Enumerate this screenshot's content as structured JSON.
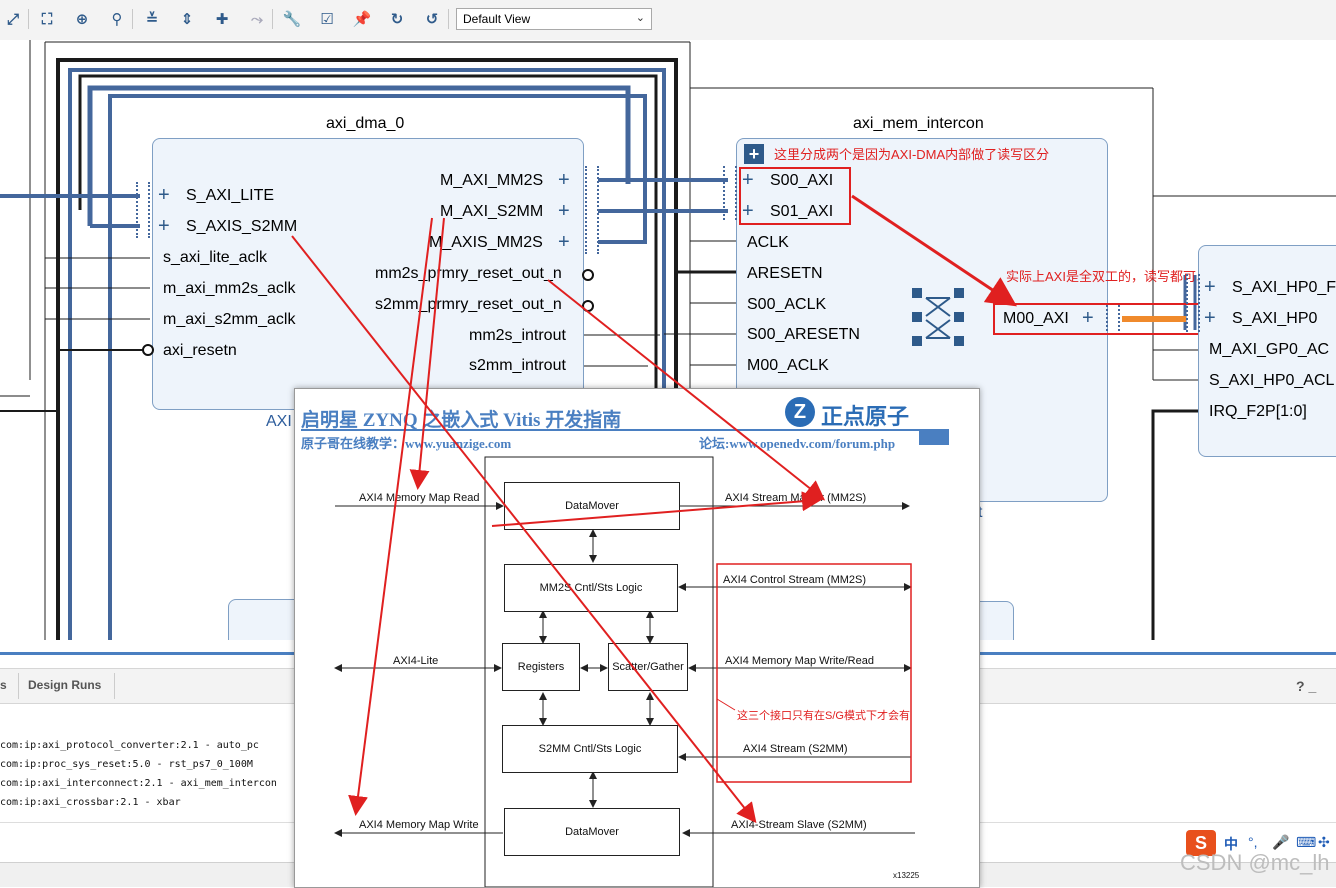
{
  "toolbar": {
    "icons": [
      "fit-icon",
      "fit-selection-icon",
      "auto-connect-icon",
      "zoom-icon",
      "collapse-icon",
      "expand-icon",
      "add-ip-icon",
      "run-connection-icon",
      "properties-icon",
      "validate-icon",
      "pin-icon",
      "refresh-icon",
      "regenerate-layout-icon"
    ],
    "view_label": "Default View"
  },
  "diagram": {
    "dma": {
      "name": "axi_dma_0",
      "left_ports": [
        "S_AXI_LITE",
        "S_AXIS_S2MM",
        "s_axi_lite_aclk",
        "m_axi_mm2s_aclk",
        "m_axi_s2mm_aclk",
        "axi_resetn"
      ],
      "right_ports": [
        "M_AXI_MM2S",
        "M_AXI_S2MM",
        "M_AXIS_MM2S",
        "mm2s_prmry_reset_out_n",
        "s2mm_prmry_reset_out_n",
        "mm2s_introut",
        "s2mm_introut"
      ],
      "footer_fragment": "AXI"
    },
    "interconnect": {
      "name": "axi_mem_intercon",
      "left_ports": [
        "S00_AXI",
        "S01_AXI",
        "ACLK",
        "ARESETN",
        "S00_ACLK",
        "S00_ARESETN",
        "M00_ACLK"
      ],
      "right_port": "M00_AXI",
      "footer_fragment": "t"
    },
    "zynq_ports": [
      "S_AXI_HP0_F",
      "S_AXI_HP0",
      "M_AXI_GP0_AC",
      "S_AXI_HP0_ACL",
      "IRQ_F2P[1:0]"
    ],
    "notes": {
      "split": "这里分成两个是因为AXI-DMA内部做了读写区分",
      "duplex": "实际上AXI是全双工的，读写都可以"
    },
    "colors": {
      "bus": "#44679c",
      "wire": "#1a1a1a",
      "block_bg": "#eef4fb",
      "block_border": "#7f9fc4",
      "annot": "#e02020",
      "hp_link": "#f08a2c"
    }
  },
  "bottom_panel": {
    "tabs": [
      "s",
      "Design Runs"
    ],
    "lines": [
      "com:ip:axi_protocol_converter:2.1 - auto_pc",
      "com:ip:proc_sys_reset:5.0 - rst_ps7_0_100M",
      "com:ip:axi_interconnect:2.1 - axi_mem_intercon",
      "com:ip:axi_crossbar:2.1 - xbar"
    ],
    "help": "? _"
  },
  "overlay": {
    "header_title": "启明星 ZYNQ 之嵌入式 Vitis 开发指南",
    "brand": "正点原子",
    "left_caption": "原子哥在线教学：www.yuanzige.com",
    "right_caption": "论坛:www.openedv.com/forum.php",
    "blocks": {
      "datamover_top": "DataMover",
      "mm2s_logic": "MM2S Cntl/Sts Logic",
      "registers": "Registers",
      "scatter_gather": "Scatter/Gather",
      "s2mm_logic": "S2MM Cntl/Sts Logic",
      "datamover_bottom": "DataMover"
    },
    "signals": {
      "mm_read": "AXI4 Memory Map Read",
      "stream_master": "AXI4 Stream Master (MM2S)",
      "control_stream": "AXI4 Control Stream (MM2S)",
      "axi_lite": "AXI4-Lite",
      "mm_write_read": "AXI4 Memory Map Write/Read",
      "sg_note": "这三个接口只有在S/G模式下才会有",
      "stream_s2mm": "AXI4 Stream (S2MM)",
      "mm_write": "AXI4 Memory Map Write",
      "stream_slave": "AXI4-Stream Slave (S2MM)"
    },
    "figure_id": "x13225"
  },
  "taskbar": {
    "ime": "中",
    "watermark": "CSDN @mc_lh"
  }
}
